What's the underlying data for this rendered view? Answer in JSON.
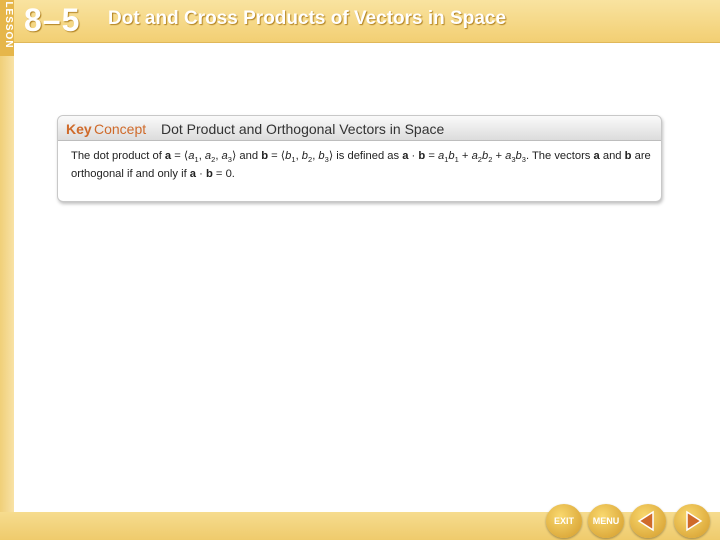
{
  "header": {
    "lesson_label": "LESSON",
    "lesson_number": "8–5",
    "title": "Dot and Cross Products of Vectors in Space"
  },
  "key_concept": {
    "key": "Key",
    "concept": "Concept",
    "title": "Dot Product and Orthogonal Vectors in Space",
    "body": {
      "t1": "The dot product of ",
      "a": "a",
      "t2": " = ⟨",
      "a_comp": "a",
      "i1": "1",
      "sep1": ", ",
      "i2": "2",
      "sep2": ", ",
      "i3": "3",
      "t3": "⟩ and ",
      "b": "b",
      "b_comp": "b",
      "t4": "⟩ is defined as ",
      "dot": " · ",
      "t5": " = ",
      "plus": " + ",
      "t6": ". The vectors ",
      "and": " and ",
      "t7": " are orthogonal if and only if ",
      "t8": " = 0."
    }
  },
  "nav": {
    "exit_label": "EXIT",
    "menu_label": "MENU",
    "prev_icon": "triangle-left",
    "next_icon": "triangle-right"
  },
  "colors": {
    "frame": "#f6dc8f",
    "accent_orange": "#cf6a2a",
    "button_gold": "#d39a2a"
  }
}
